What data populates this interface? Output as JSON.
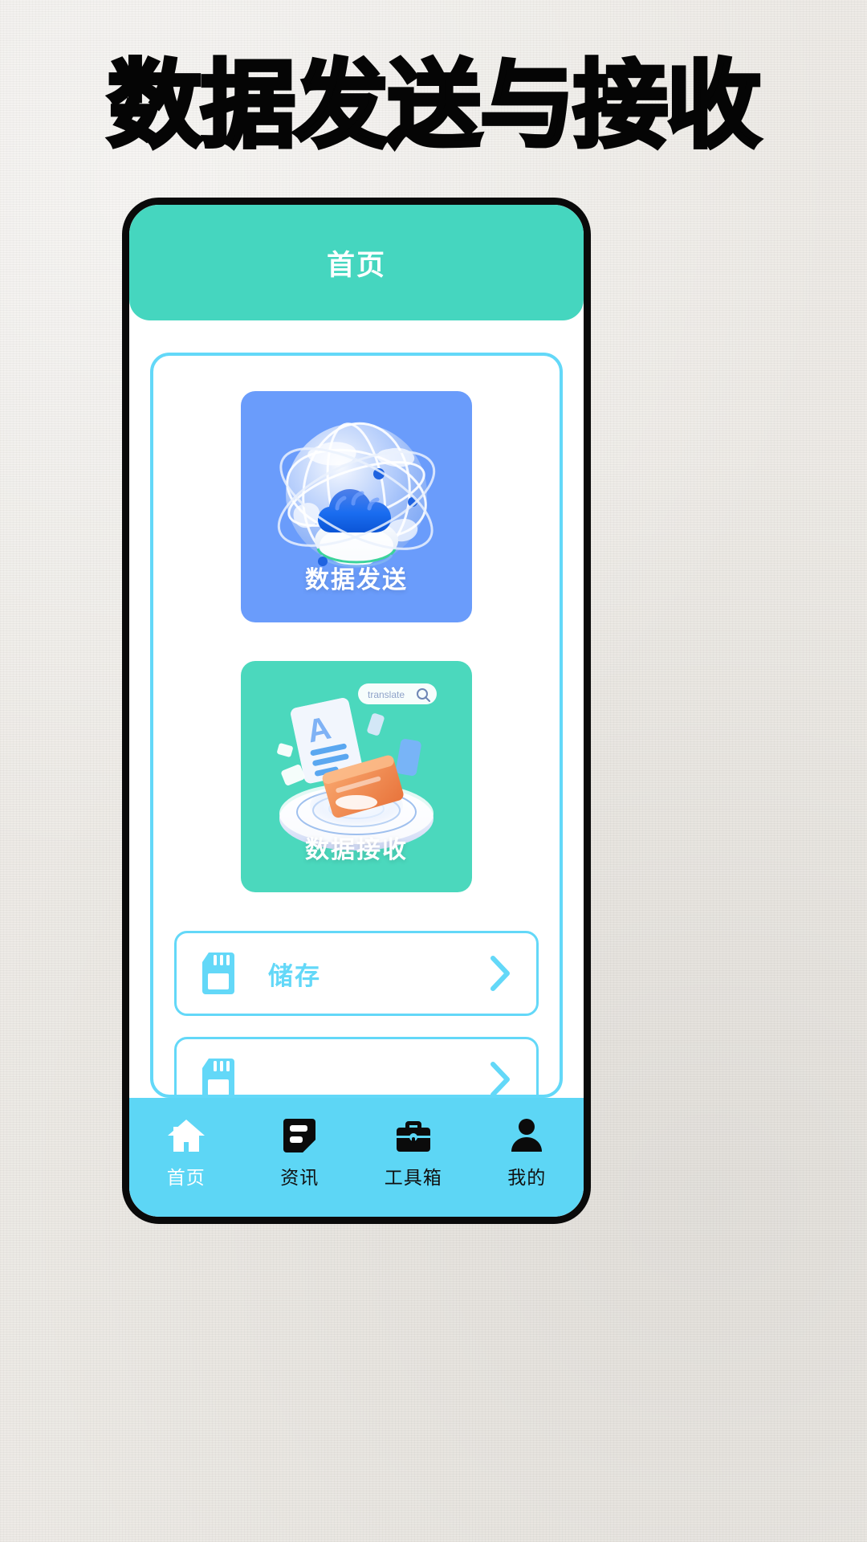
{
  "poster": {
    "title": "数据发送与接收"
  },
  "app": {
    "header": {
      "title": "首页"
    },
    "cards": [
      {
        "label": "数据发送",
        "icon": "globe-cloud-network-icon",
        "bg": "#6A9CFB"
      },
      {
        "label": "数据接收",
        "icon": "document-translate-portal-icon",
        "bg": "#4BD8BD"
      }
    ],
    "rows": [
      {
        "label": "储存",
        "icon": "sd-card-icon",
        "chevron": "chevron-right-icon",
        "accent": "#63D8F8"
      },
      {
        "label": "",
        "icon": "sd-card-icon",
        "chevron": "chevron-right-icon",
        "accent": "#63D8F8"
      }
    ],
    "tabs": [
      {
        "label": "首页",
        "icon": "home-icon",
        "active": true
      },
      {
        "label": "资讯",
        "icon": "news-doc-icon",
        "active": false
      },
      {
        "label": "工具箱",
        "icon": "briefcase-icon",
        "active": false
      },
      {
        "label": "我的",
        "icon": "person-icon",
        "active": false
      }
    ],
    "colors": {
      "header_teal": "#45D6BF",
      "tabbar_cyan": "#5DD6F5",
      "panel_border": "#63D8F8",
      "send_card": "#6A9CFB",
      "receive_card": "#4BD8BD"
    }
  }
}
